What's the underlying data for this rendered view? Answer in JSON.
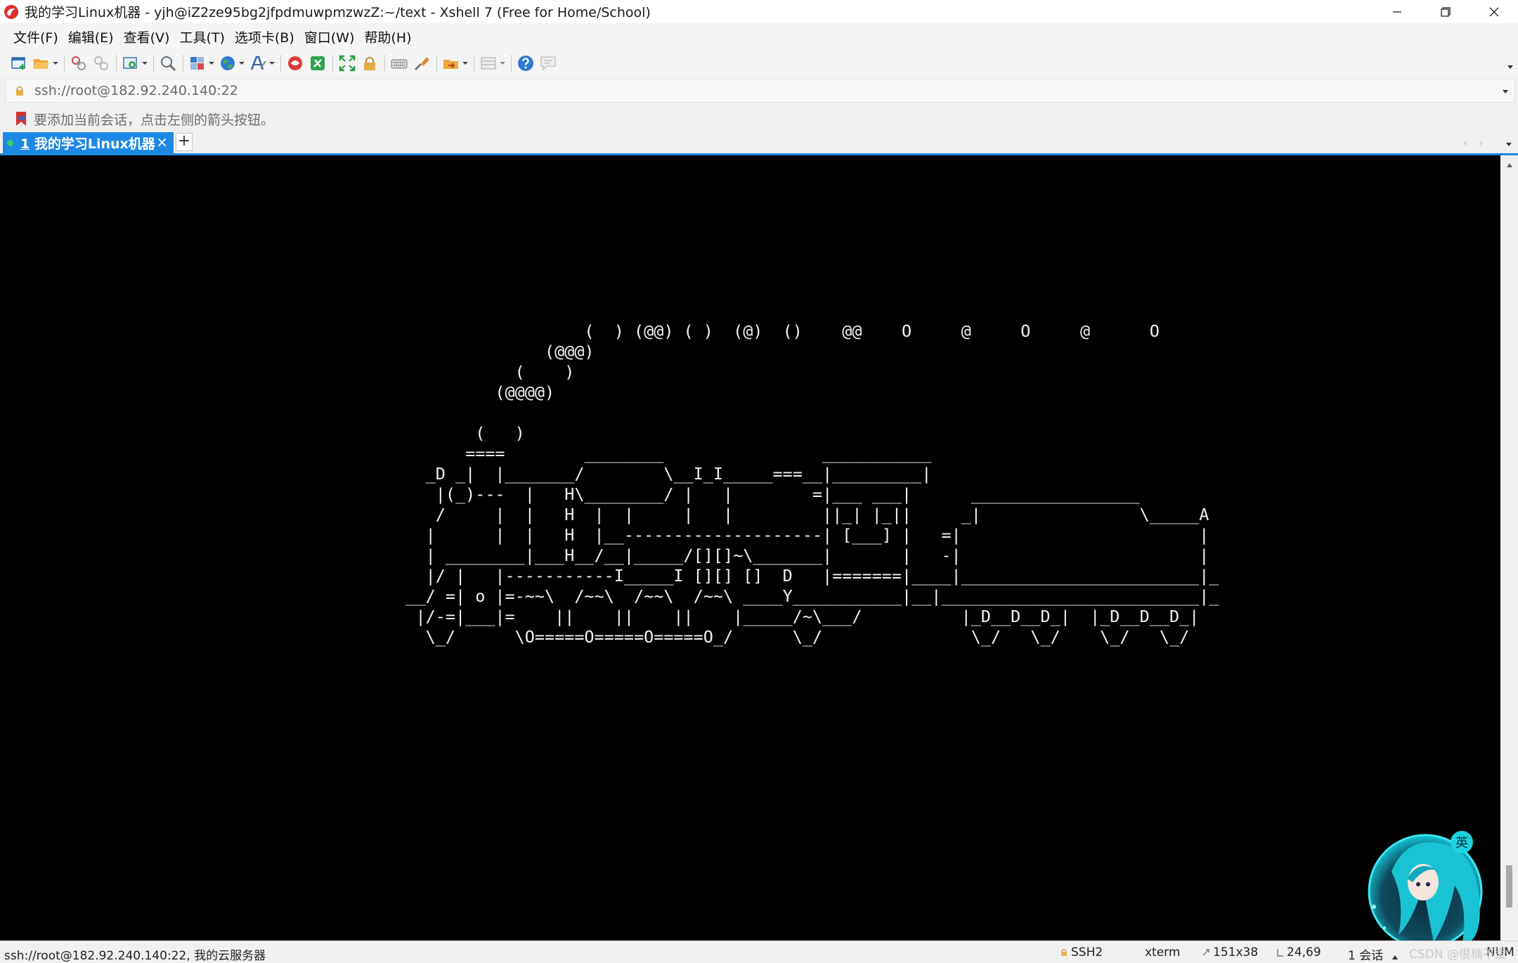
{
  "window": {
    "title": "我的学习Linux机器 - yjh@iZ2ze95bg2jfpdmuwpmzwzZ:~/text - Xshell 7 (Free for Home/School)"
  },
  "menu": [
    "文件(F)",
    "编辑(E)",
    "查看(V)",
    "工具(T)",
    "选项卡(B)",
    "窗口(W)",
    "帮助(H)"
  ],
  "address": {
    "value": "ssh://root@182.92.240.140:22"
  },
  "session_hint": "要添加当前会话，点击左侧的箭头按钮。",
  "tab": {
    "number": "1",
    "label": " 我的学习Linux机器",
    "close": "×",
    "add": "+"
  },
  "terminal": {
    "text": "                      (  ) (@@) ( )  (@)  ()    @@    O     @     O     @      O\n                  (@@@)\n               (    )\n             (@@@@)\n\n           (   )\n          ====        ________                ___________\n      _D _|  |_______/        \\__I_I_____===__|_________|\n       |(_)---  |   H\\________/ |   |        =|___ ___|      _________________\n       /     |  |   H  |  |     |   |         ||_| |_||     _|                \\_____A\n      |      |  |   H  |__--------------------| [___] |   =|                        |\n      | ________|___H__/__|_____/[][]~\\_______|       |   -|                        |\n      |/ |   |-----------I_____I [][] []  D   |=======|____|________________________|_\n    __/ =| o |=-~~\\  /~~\\  /~~\\  /~~\\ ____Y___________|__|__________________________|_\n     |/-=|___|=    ||    ||    ||    |_____/~\\___/          |_D__D__D_|  |_D__D__D_|\n      \\_/      \\O=====O=====O=====O_/      \\_/               \\_/   \\_/    \\_/   \\_/"
  },
  "status": {
    "connection": "ssh://root@182.92.240.140:22, 我的云服务器",
    "protocol": "SSH2",
    "term": "xterm",
    "size": "151x38",
    "cursor": "24,69",
    "sessions": "1 会话",
    "num": "NUM"
  },
  "watermark": "CSDN @很楠不爱",
  "colors": {
    "accent": "#1e88e5",
    "terminal_bg": "#000000",
    "terminal_fg": "#f2f2f2",
    "session_dot": "#34d16b"
  },
  "icons": [
    "xshell-logo-icon",
    "minimize-icon",
    "maximize-icon",
    "close-icon",
    "new-session-icon",
    "open-folder-icon",
    "connect-icon",
    "disconnect-icon",
    "properties-icon",
    "find-icon",
    "layout-icon",
    "globe-icon",
    "font-icon",
    "xftp-icon",
    "xmanager-icon",
    "fullscreen-icon",
    "lock-icon",
    "keyboard-icon",
    "highlight-icon",
    "transfer-icon",
    "compose-icon",
    "help-icon",
    "chat-icon",
    "bookmark-arrow-icon",
    "mascot-avatar"
  ]
}
